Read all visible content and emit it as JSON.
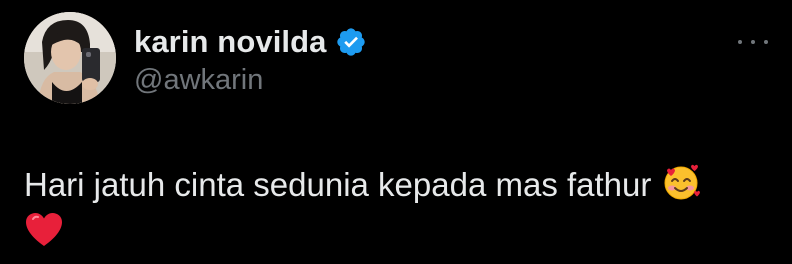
{
  "author": {
    "display_name": "karin novilda",
    "handle": "@awkarin",
    "verified_color": "#1d9bf0"
  },
  "tweet": {
    "text": "Hari jatuh cinta sedunia kepada mas fathur",
    "emojis": [
      "smiling-face-with-hearts",
      "red-heart"
    ]
  },
  "icons": {
    "verified": "verified-badge-icon",
    "more": "more-options-icon"
  },
  "colors": {
    "background": "#000000",
    "primary_text": "#e7e9ea",
    "secondary_text": "#71767b",
    "heart": "#e8203a"
  }
}
